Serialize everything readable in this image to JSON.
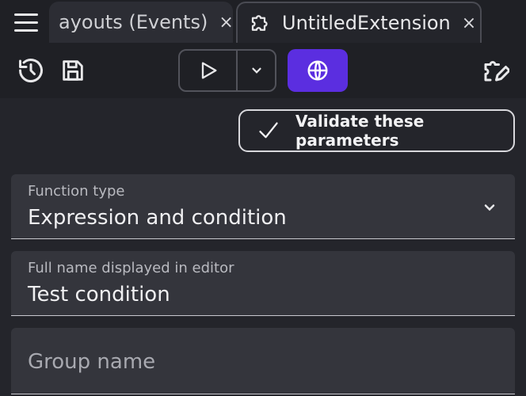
{
  "tabs": [
    {
      "label": "ayouts (Events)",
      "close": "×",
      "active": false
    },
    {
      "label": "UntitledExtension",
      "close": "×",
      "active": true
    }
  ],
  "toolbar": {
    "icons": [
      "history-icon",
      "save-icon",
      "play-icon",
      "chevron-down-icon",
      "globe-icon",
      "edit-icon"
    ],
    "preview_color": "#5b2ee0"
  },
  "validate_button": {
    "label": "Validate these parameters"
  },
  "fields": {
    "function_type": {
      "label": "Function type",
      "value": "Expression and condition"
    },
    "full_name": {
      "label": "Full name displayed in editor",
      "value": "Test condition"
    },
    "group_name": {
      "placeholder": "Group name"
    }
  }
}
